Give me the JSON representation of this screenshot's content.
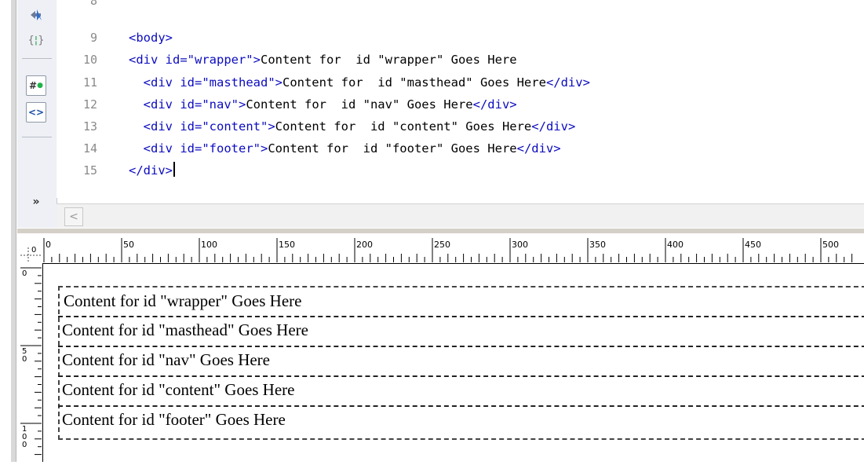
{
  "toolbar": {
    "icons": [
      "select-icon",
      "code-hint-icon",
      "css-id-icon",
      "validate-icon",
      "expand-icon"
    ]
  },
  "editor": {
    "lines": [
      {
        "n": "8",
        "text": ""
      },
      {
        "n": "9",
        "text": "<body>"
      },
      {
        "n": "10",
        "text": "<div id=\"wrapper\">Content for  id \"wrapper\" Goes Here"
      },
      {
        "n": "11",
        "text": "  <div id=\"masthead\">Content for  id \"masthead\" Goes Here</div>"
      },
      {
        "n": "12",
        "text": "  <div id=\"nav\">Content for  id \"nav\" Goes Here</div>"
      },
      {
        "n": "13",
        "text": "  <div id=\"content\">Content for  id \"content\" Goes Here</div>"
      },
      {
        "n": "14",
        "text": "  <div id=\"footer\">Content for  id \"footer\" Goes Here</div>"
      },
      {
        "n": "15",
        "text": "</div>"
      }
    ]
  },
  "scroll": {
    "left_arrow": "<"
  },
  "ruler": {
    "h_labels": [
      "0",
      "50",
      "100",
      "150",
      "200",
      "250",
      "300",
      "350",
      "400",
      "450",
      "500"
    ],
    "v_labels": [
      "0",
      "50",
      "100"
    ]
  },
  "design": {
    "wrapper": "Content for id \"wrapper\" Goes Here",
    "masthead": "Content for id \"masthead\" Goes Here",
    "nav": "Content for id \"nav\" Goes Here",
    "content": "Content for id \"content\" Goes Here",
    "footer": "Content for id \"footer\" Goes Here"
  }
}
